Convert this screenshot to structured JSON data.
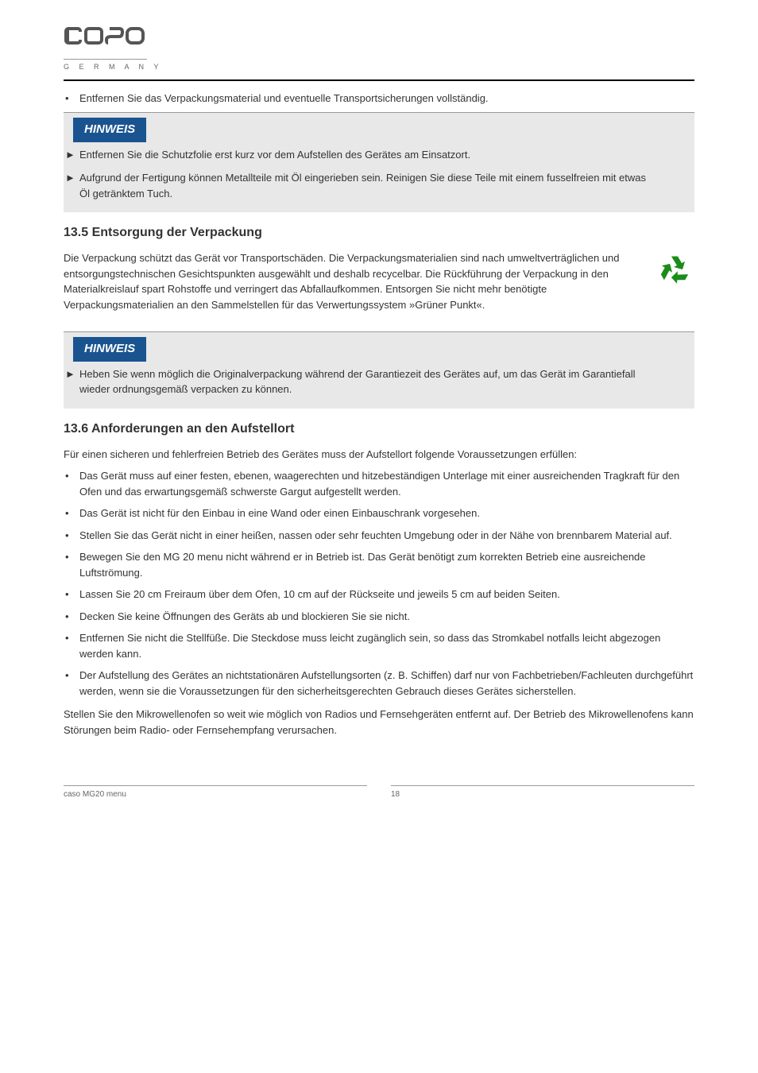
{
  "logo": {
    "brand": "caso",
    "sub": "G E R M A N Y"
  },
  "intro_bullet": "Entfernen Sie das Verpackungsmaterial und eventuelle Transportsicherungen vollständig.",
  "hinweis1": {
    "label": "HINWEIS",
    "items": [
      "Entfernen Sie die Schutzfolie erst kurz vor dem Aufstellen des Gerätes am Einsatzort.",
      "Aufgrund der Fertigung können Metallteile mit Öl eingerieben sein. Reinigen Sie diese Teile mit einem fusselfreien mit etwas Öl getränktem Tuch."
    ]
  },
  "packaging": {
    "heading": "13.5 Entsorgung der Verpackung",
    "text": "Die Verpackung schützt das Gerät vor Transportschäden. Die Verpackungsmaterialien sind nach umweltverträglichen und entsorgungstechnischen Gesichtspunkten ausgewählt und deshalb recycelbar. Die Rückführung der Verpackung in den Materialkreislauf spart Rohstoffe und verringert das Abfallaufkommen. Entsorgen Sie nicht mehr benötigte Verpackungsmaterialien an den Sammelstellen für das Verwertungssystem »Grüner Punkt«."
  },
  "hinweis2": {
    "label": "HINWEIS",
    "items": [
      "Heben Sie wenn möglich die Originalverpackung während der Garantiezeit des Gerätes auf, um das Gerät im Garantiefall wieder ordnungsgemäß verpacken zu können."
    ]
  },
  "location": {
    "heading": "13.6 Anforderungen an den Aufstellort",
    "intro": "Für einen sicheren und fehlerfreien Betrieb des Gerätes muss der Aufstellort folgende Voraussetzungen erfüllen:",
    "items": [
      "Das Gerät muss auf einer festen, ebenen, waagerechten und hitzebeständigen Unterlage mit einer ausreichenden Tragkraft für den Ofen und das erwartungsgemäß schwerste Gargut aufgestellt werden.",
      "Das Gerät ist nicht für den Einbau in eine Wand oder einen Einbauschrank vorgesehen.",
      "Stellen Sie das Gerät nicht in einer heißen, nassen oder sehr feuchten Umgebung oder in der Nähe von brennbarem Material auf.",
      "Bewegen Sie den MG 20 menu nicht während er in Betrieb ist. Das Gerät benötigt zum korrekten Betrieb eine ausreichende Luftströmung.",
      "Lassen Sie 20 cm Freiraum über dem Ofen, 10 cm auf der Rückseite und jeweils 5 cm auf beiden Seiten.",
      "Decken Sie keine Öffnungen des Geräts ab und blockieren Sie sie nicht.",
      "Entfernen Sie nicht die Stellfüße. Die Steckdose muss leicht zugänglich sein, so dass das Stromkabel notfalls leicht abgezogen werden kann.",
      "Der Aufstellung des Gerätes an nichtstationären Aufstellungsorten (z. B. Schiffen) darf nur von Fachbetrieben/Fachleuten durchgeführt werden, wenn sie die Voraussetzungen für den sicherheitsgerechten Gebrauch dieses Gerätes sicherstellen."
    ],
    "final": "Stellen Sie den Mikrowellenofen so weit wie möglich von Radios und Fernsehgeräten entfernt auf. Der Betrieb des Mikrowellenofens kann Störungen beim Radio- oder Fernsehempfang verursachen."
  },
  "footer": {
    "left": "caso MG20 menu",
    "right": "18"
  }
}
